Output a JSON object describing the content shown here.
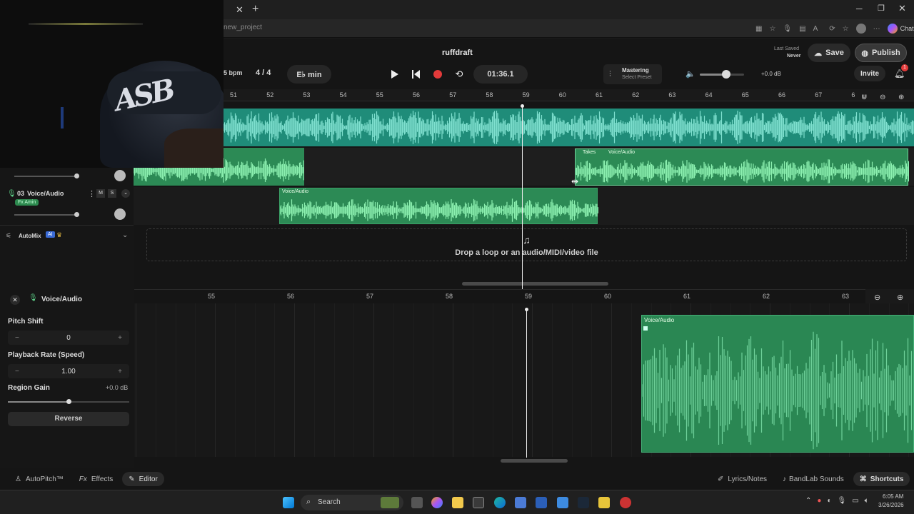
{
  "browser": {
    "url": "new_project",
    "chat_label": "Chat"
  },
  "header": {
    "project_title": "ruffdraft",
    "bpm_label": "5 bpm",
    "time_signature": "4 / 4",
    "key": "E♭ min",
    "time_display": "01:36.1",
    "mastering_label": "Mastering",
    "mastering_sub": "Select Preset",
    "volume_db": "+0.0 dB",
    "volume_level": 0.6,
    "last_saved_label": "Last Saved",
    "last_saved_value": "Never",
    "save_label": "Save",
    "publish_label": "Publish",
    "invite_label": "Invite",
    "notification_count": "1"
  },
  "timeline": {
    "bars": [
      "51",
      "52",
      "53",
      "54",
      "55",
      "56",
      "57",
      "58",
      "59",
      "60",
      "61",
      "62",
      "63",
      "64",
      "65",
      "66",
      "67",
      "6"
    ]
  },
  "tracks": [
    {
      "number": "03",
      "name": "Voice/Audio",
      "fx": "Fx Amin",
      "mute": "M",
      "solo": "S"
    }
  ],
  "clips": {
    "takes_label": "Takes",
    "clip2_label": "Voice/Audio",
    "clip3_label": "Voice/Audio"
  },
  "automix": {
    "label": "AutoMix",
    "badge": "AI"
  },
  "drop_zone": {
    "text": "Drop a loop or an audio/MIDI/video file"
  },
  "editor": {
    "track_name": "Voice/Audio",
    "pitch_shift_label": "Pitch Shift",
    "pitch_shift_value": "0",
    "playback_rate_label": "Playback Rate (Speed)",
    "playback_rate_value": "1.00",
    "region_gain_label": "Region Gain",
    "region_gain_value": "+0.0 dB",
    "reverse_label": "Reverse",
    "bars": [
      "55",
      "56",
      "57",
      "58",
      "59",
      "60",
      "61",
      "62",
      "63"
    ],
    "clip_label": "Voice/Audio"
  },
  "bottom_bar": {
    "autopitch": "AutoPitch™",
    "effects": "Effects",
    "editor": "Editor",
    "lyrics": "Lyrics/Notes",
    "bandlab_sounds": "BandLab Sounds",
    "shortcuts": "Shortcuts"
  },
  "taskbar": {
    "search_placeholder": "Search",
    "time": "6:05 AM",
    "date": "3/26/2026"
  }
}
